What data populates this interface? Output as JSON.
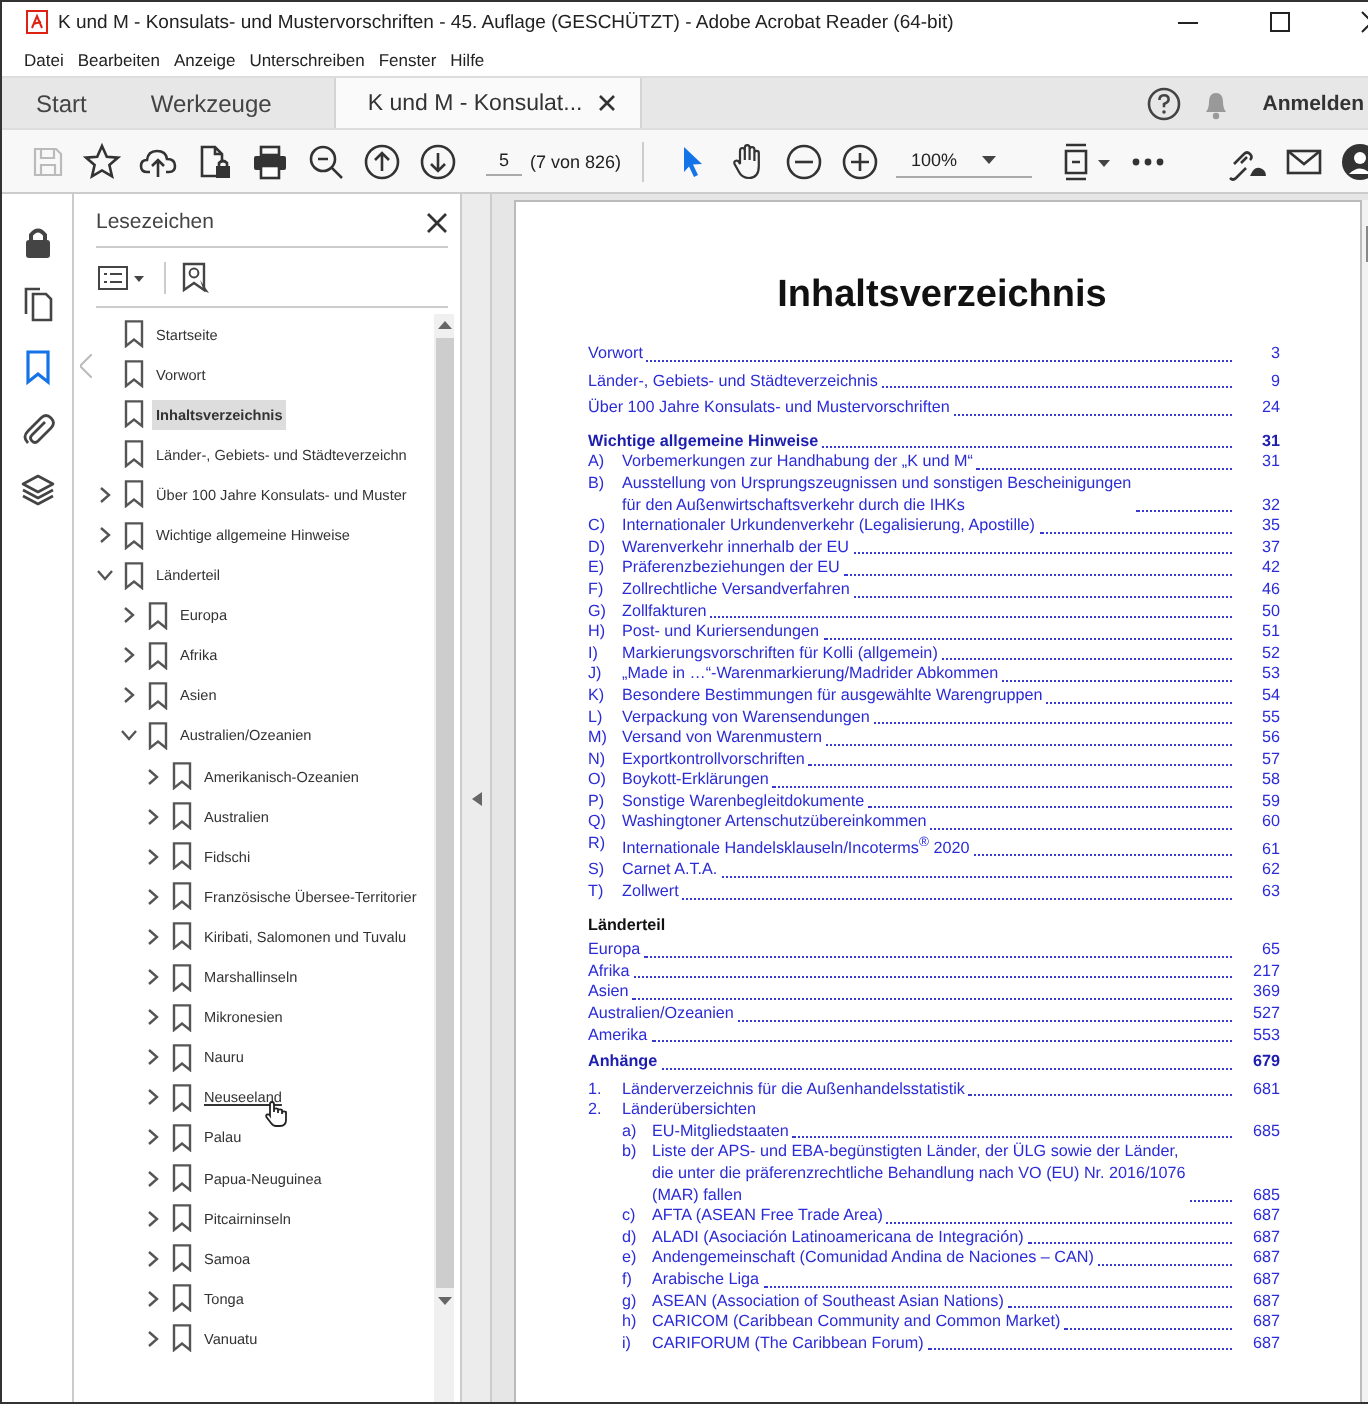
{
  "window": {
    "title": "K und M - Konsulats- und Mustervorschriften - 45. Auflage (GESCHÜTZT) - Adobe Acrobat Reader (64-bit)"
  },
  "menu": [
    "Datei",
    "Bearbeiten",
    "Anzeige",
    "Unterschreiben",
    "Fenster",
    "Hilfe"
  ],
  "tabs": [
    {
      "label": "Start",
      "selected": false
    },
    {
      "label": "Werkzeuge",
      "selected": false
    },
    {
      "label": "K und M - Konsulat...",
      "selected": true
    }
  ],
  "account": {
    "label": "Anmelden"
  },
  "toolbar": {
    "save_disabled": true,
    "page_number": "5",
    "page_count": "(7 von 826)",
    "zoom": "100%",
    "tools": [
      {
        "selected": true
      },
      {
        "selected": false
      }
    ]
  },
  "rail": [
    {
      "selected": false
    },
    {
      "selected": false
    },
    {
      "selected": true
    },
    {
      "selected": false
    },
    {
      "selected": false
    }
  ],
  "bookmarks": {
    "title": "Lesezeichen",
    "items": [
      {
        "label": "Startseite",
        "selected": false,
        "hovered": false
      },
      {
        "label": "Vorwort",
        "selected": false,
        "hovered": false
      },
      {
        "label": "Inhaltsverzeichnis",
        "selected": true,
        "hovered": false
      },
      {
        "label": "Länder-, Gebiets- und Städteverzeichn",
        "selected": false,
        "hovered": false
      },
      {
        "label": "Über 100 Jahre Konsulats- und Muster",
        "expandable": true,
        "expanded": false,
        "selected": false,
        "hovered": false
      },
      {
        "label": "Wichtige allgemeine Hinweise",
        "expandable": true,
        "expanded": false,
        "selected": false,
        "hovered": false
      },
      {
        "label": "Länderteil",
        "expandable": true,
        "expanded": true,
        "selected": false,
        "hovered": false,
        "children": [
          {
            "label": "Europa",
            "expandable": true,
            "expanded": false,
            "selected": false,
            "hovered": false
          },
          {
            "label": "Afrika",
            "expandable": true,
            "expanded": false,
            "selected": false,
            "hovered": false
          },
          {
            "label": "Asien",
            "expandable": true,
            "expanded": false,
            "selected": false,
            "hovered": false
          },
          {
            "label": "Australien/Ozeanien",
            "expandable": true,
            "expanded": true,
            "selected": false,
            "hovered": false,
            "children": [
              {
                "label": "Amerikanisch-Ozeanien",
                "expandable": true,
                "expanded": false,
                "selected": false,
                "hovered": false
              },
              {
                "label": "Australien",
                "expandable": true,
                "expanded": false,
                "selected": false,
                "hovered": false
              },
              {
                "label": "Fidschi",
                "expandable": true,
                "expanded": false,
                "selected": false,
                "hovered": false
              },
              {
                "label": "Französische Übersee-Territorier",
                "expandable": true,
                "expanded": false,
                "selected": false,
                "hovered": false
              },
              {
                "label": "Kiribati, Salomonen und Tuvalu",
                "expandable": true,
                "expanded": false,
                "selected": false,
                "hovered": false
              },
              {
                "label": "Marshallinseln",
                "expandable": true,
                "expanded": false,
                "selected": false,
                "hovered": false
              },
              {
                "label": "Mikronesien",
                "expandable": true,
                "expanded": false,
                "selected": false,
                "hovered": false
              },
              {
                "label": "Nauru",
                "expandable": true,
                "expanded": false,
                "selected": false,
                "hovered": false
              },
              {
                "label": "Neuseeland",
                "expandable": true,
                "expanded": false,
                "selected": false,
                "hovered": true
              },
              {
                "label": "Palau",
                "expandable": true,
                "expanded": false,
                "selected": false,
                "hovered": false
              },
              {
                "label": "Papua-Neuguinea",
                "expandable": true,
                "expanded": false,
                "selected": false,
                "hovered": false
              },
              {
                "label": "Pitcairninseln",
                "expandable": true,
                "expanded": false,
                "selected": false,
                "hovered": false
              },
              {
                "label": "Samoa",
                "expandable": true,
                "expanded": false,
                "selected": false,
                "hovered": false
              },
              {
                "label": "Tonga",
                "expandable": true,
                "expanded": false,
                "selected": false,
                "hovered": false
              },
              {
                "label": "Vanuatu",
                "expandable": true,
                "expanded": false,
                "selected": false,
                "hovered": false
              }
            ]
          }
        ]
      }
    ]
  },
  "document": {
    "title": "Inhaltsverzeichnis",
    "groups": [
      [
        {
          "kind": "entry",
          "text": "Vorwort",
          "page": "3"
        }
      ],
      [
        {
          "kind": "entry",
          "text": "Länder-, Gebiets- und Städteverzeichnis",
          "page": "9"
        }
      ],
      [
        {
          "kind": "entry",
          "text": "Über 100 Jahre Konsulats- und Mustervorschriften",
          "page": "24"
        }
      ],
      [
        {
          "kind": "heading",
          "text": "Wichtige allgemeine Hinweise",
          "page": "31"
        },
        {
          "kind": "item",
          "label": "A)",
          "text": "Vorbemerkungen zur Handhabung der „K und M“",
          "page": "31"
        },
        {
          "kind": "item",
          "label": "B)",
          "text": "Ausstellung von Ursprungszeugnissen und sonstigen Bescheinigungen\nfür den Außenwirtschaftsverkehr durch die IHKs",
          "page": "32"
        },
        {
          "kind": "item",
          "label": "C)",
          "text": "Internationaler Urkundenverkehr (Legalisierung, Apostille)",
          "page": "35"
        },
        {
          "kind": "item",
          "label": "D)",
          "text": "Warenverkehr innerhalb der EU",
          "page": "37"
        },
        {
          "kind": "item",
          "label": "E)",
          "text": "Präferenzbeziehungen der EU",
          "page": "42"
        },
        {
          "kind": "item",
          "label": "F)",
          "text": "Zollrechtliche Versandverfahren",
          "page": "46"
        },
        {
          "kind": "item",
          "label": "G)",
          "text": "Zollfakturen",
          "page": "50"
        },
        {
          "kind": "item",
          "label": "H)",
          "text": "Post- und Kuriersendungen",
          "page": "51"
        },
        {
          "kind": "item",
          "label": "I)",
          "text": "Markierungsvorschriften für Kolli (allgemein)",
          "page": "52"
        },
        {
          "kind": "item",
          "label": "J)",
          "text": "„Made in …“-Warenmarkierung/Madrider Abkommen",
          "page": "53"
        },
        {
          "kind": "item",
          "label": "K)",
          "text": "Besondere Bestimmungen für ausgewählte Warengruppen",
          "page": "54"
        },
        {
          "kind": "item",
          "label": "L)",
          "text": "Verpackung von Warensendungen",
          "page": "55"
        },
        {
          "kind": "item",
          "label": "M)",
          "text": "Versand von Warenmustern",
          "page": "56"
        },
        {
          "kind": "item",
          "label": "N)",
          "text": "Exportkontrollvorschriften",
          "page": "57"
        },
        {
          "kind": "item",
          "label": "O)",
          "text": "Boykott-Erklärungen",
          "page": "58"
        },
        {
          "kind": "item",
          "label": "P)",
          "text": "Sonstige Warenbegleitdokumente",
          "page": "59"
        },
        {
          "kind": "item",
          "label": "Q)",
          "text": "Washingtoner Artenschutzübereinkommen",
          "page": "60"
        },
        {
          "kind": "item",
          "label": "R)",
          "text": "Internationale Handelsklauseln/Incoterms$^{®}$ 2020",
          "page": "61"
        },
        {
          "kind": "item",
          "label": "S)",
          "text": "Carnet A.T.A.",
          "page": "62"
        },
        {
          "kind": "item",
          "label": "T)",
          "text": "Zollwert",
          "page": "63"
        }
      ],
      [
        {
          "kind": "section",
          "text": "Länderteil"
        },
        {
          "kind": "entry",
          "text": "Europa",
          "page": "65"
        },
        {
          "kind": "entry",
          "text": "Afrika",
          "page": "217"
        },
        {
          "kind": "entry",
          "text": "Asien",
          "page": "369"
        },
        {
          "kind": "entry",
          "text": "Australien/Ozeanien",
          "page": "527"
        },
        {
          "kind": "entry",
          "text": "Amerika",
          "page": "553"
        }
      ],
      [
        {
          "kind": "heading",
          "text": "Anhänge",
          "page": "679"
        }
      ],
      [
        {
          "kind": "item",
          "label": "1.",
          "text": "Länderverzeichnis für die Außenhandelsstatistik",
          "page": "681"
        },
        {
          "kind": "item",
          "label": "2.",
          "text": "Länderübersichten"
        },
        {
          "kind": "subitem",
          "label": "a)",
          "text": "EU-Mitgliedstaaten",
          "page": "685"
        },
        {
          "kind": "subitem",
          "label": "b)",
          "text": "Liste der APS- und EBA-begünstigten Länder, der ÜLG sowie der Länder,\ndie unter die präferenzrechtliche Behandlung nach VO (EU) Nr. 2016/1076\n(MAR) fallen",
          "page": "685"
        },
        {
          "kind": "subitem",
          "label": "c)",
          "text": "AFTA (ASEAN Free Trade Area)",
          "page": "687"
        },
        {
          "kind": "subitem",
          "label": "d)",
          "text": "ALADI (Asociación Latinoamericana de Integración)",
          "page": "687"
        },
        {
          "kind": "subitem",
          "label": "e)",
          "text": "Andengemeinschaft (Comunidad Andina de Naciones – CAN)",
          "page": "687"
        },
        {
          "kind": "subitem",
          "label": "f)",
          "text": "Arabische Liga",
          "page": "687"
        },
        {
          "kind": "subitem",
          "label": "g)",
          "text": "ASEAN (Association of Southeast Asian Nations)",
          "page": "687"
        },
        {
          "kind": "subitem",
          "label": "h)",
          "text": "CARICOM (Caribbean Community and Common Market)",
          "page": "687"
        },
        {
          "kind": "subitem",
          "label": "i)",
          "text": "CARIFORUM (The Caribbean Forum)",
          "page": "687"
        }
      ]
    ]
  }
}
